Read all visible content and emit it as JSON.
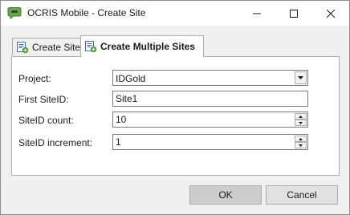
{
  "window": {
    "title": "OCRIS Mobile - Create Site",
    "app_icon": "speech-bubble-icon",
    "accent": "#6aa84f"
  },
  "tabs": [
    {
      "label": "Create Site",
      "icon": "site-add-icon",
      "selected": false
    },
    {
      "label": "Create Multiple Sites",
      "icon": "site-add-icon",
      "selected": true
    }
  ],
  "form": {
    "project": {
      "label": "Project:",
      "value": "IDGold"
    },
    "first_site_id": {
      "label": "First SiteID:",
      "value": "Site1"
    },
    "site_id_count": {
      "label": "SiteID count:",
      "value": "10"
    },
    "site_id_increment": {
      "label": "SiteID increment:",
      "value": "1"
    }
  },
  "buttons": {
    "ok": "OK",
    "cancel": "Cancel"
  }
}
